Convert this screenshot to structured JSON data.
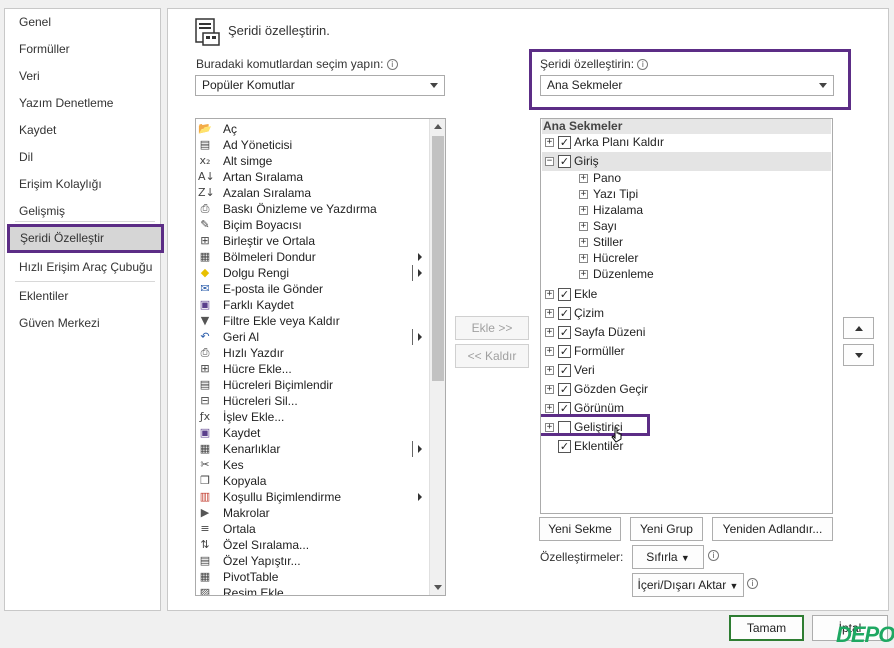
{
  "nav": {
    "items": [
      {
        "label": "Genel"
      },
      {
        "label": "Formüller"
      },
      {
        "label": "Veri"
      },
      {
        "label": "Yazım Denetleme"
      },
      {
        "label": "Kaydet"
      },
      {
        "label": "Dil"
      },
      {
        "label": "Erişim Kolaylığı"
      },
      {
        "label": "Gelişmiş"
      },
      {
        "label": "Şeridi Özelleştir",
        "selected": true
      },
      {
        "label": "Hızlı Erişim Araç Çubuğu"
      },
      {
        "label": "Eklentiler"
      },
      {
        "label": "Güven Merkezi"
      }
    ]
  },
  "header": {
    "title": "Şeridi özelleştirin."
  },
  "left_panel": {
    "label": "Buradaki komutlardan seçim yapın:",
    "selected": "Popüler Komutlar",
    "commands": [
      {
        "label": "Aç",
        "icon": "folder-icon"
      },
      {
        "label": "Ad Yöneticisi",
        "icon": "name-manager-icon"
      },
      {
        "label": "Alt simge",
        "icon": "subscript-icon"
      },
      {
        "label": "Artan Sıralama",
        "icon": "sort-ascending-icon"
      },
      {
        "label": "Azalan Sıralama",
        "icon": "sort-descending-icon"
      },
      {
        "label": "Baskı Önizleme ve Yazdırma",
        "icon": "print-preview-icon"
      },
      {
        "label": "Biçim Boyacısı",
        "icon": "format-painter-icon"
      },
      {
        "label": "Birleştir ve Ortala",
        "icon": "merge-center-icon"
      },
      {
        "label": "Bölmeleri Dondur",
        "icon": "freeze-panes-icon",
        "submenu": true
      },
      {
        "label": "Dolgu Rengi",
        "icon": "fill-color-icon",
        "submenu": true,
        "split": true
      },
      {
        "label": "E-posta ile Gönder",
        "icon": "email-icon"
      },
      {
        "label": "Farklı Kaydet",
        "icon": "save-as-icon"
      },
      {
        "label": "Filtre Ekle veya Kaldır",
        "icon": "filter-icon"
      },
      {
        "label": "Geri Al",
        "icon": "undo-icon",
        "submenu": true,
        "split": true
      },
      {
        "label": "Hızlı Yazdır",
        "icon": "quick-print-icon"
      },
      {
        "label": "Hücre Ekle...",
        "icon": "insert-cells-icon"
      },
      {
        "label": "Hücreleri Biçimlendir",
        "icon": "format-cells-icon"
      },
      {
        "label": "Hücreleri Sil...",
        "icon": "delete-cells-icon"
      },
      {
        "label": "İşlev Ekle...",
        "icon": "insert-function-icon"
      },
      {
        "label": "Kaydet",
        "icon": "save-icon"
      },
      {
        "label": "Kenarlıklar",
        "icon": "borders-icon",
        "submenu": true,
        "split": true
      },
      {
        "label": "Kes",
        "icon": "cut-icon"
      },
      {
        "label": "Kopyala",
        "icon": "copy-icon"
      },
      {
        "label": "Koşullu Biçimlendirme",
        "icon": "conditional-format-icon",
        "submenu": true
      },
      {
        "label": "Makrolar",
        "icon": "macros-icon"
      },
      {
        "label": "Ortala",
        "icon": "align-center-icon"
      },
      {
        "label": "Özel Sıralama...",
        "icon": "custom-sort-icon"
      },
      {
        "label": "Özel Yapıştır...",
        "icon": "paste-special-icon"
      },
      {
        "label": "PivotTable",
        "icon": "pivot-table-icon"
      },
      {
        "label": "Resim Ekle",
        "icon": "insert-picture-icon"
      }
    ]
  },
  "middle": {
    "add_label": "Ekle >>",
    "remove_label": "<< Kaldır"
  },
  "right_panel": {
    "label": "Şeridi özelleştirin:",
    "selected": "Ana Sekmeler",
    "tree_header": "Ana Sekmeler",
    "tabs": [
      {
        "label": "Arka Planı Kaldır",
        "checked": true,
        "expanded": false
      },
      {
        "label": "Giriş",
        "checked": true,
        "expanded": true,
        "groups": [
          "Pano",
          "Yazı Tipi",
          "Hizalama",
          "Sayı",
          "Stiller",
          "Hücreler",
          "Düzenleme"
        ]
      },
      {
        "label": "Ekle",
        "checked": true,
        "expanded": false
      },
      {
        "label": "Çizim",
        "checked": true,
        "expanded": false
      },
      {
        "label": "Sayfa Düzeni",
        "checked": true,
        "expanded": false
      },
      {
        "label": "Formüller",
        "checked": true,
        "expanded": false
      },
      {
        "label": "Veri",
        "checked": true,
        "expanded": false
      },
      {
        "label": "Gözden Geçir",
        "checked": true,
        "expanded": false
      },
      {
        "label": "Görünüm",
        "checked": true,
        "expanded": false
      },
      {
        "label": "Geliştirici",
        "checked": false,
        "expanded": false
      },
      {
        "label": "Eklentiler",
        "checked": true,
        "expanded": null
      }
    ],
    "new_tab": "Yeni Sekme",
    "new_group": "Yeni Grup",
    "rename": "Yeniden Adlandır...",
    "customizations_label": "Özelleştirmeler:",
    "reset": "Sıfırla",
    "import_export": "İçeri/Dışarı Aktar"
  },
  "footer": {
    "ok": "Tamam",
    "cancel": "İptal",
    "watermark": "DEPO"
  },
  "colors": {
    "accent": "#5c2d86",
    "ok_border": "#2e7d32"
  }
}
